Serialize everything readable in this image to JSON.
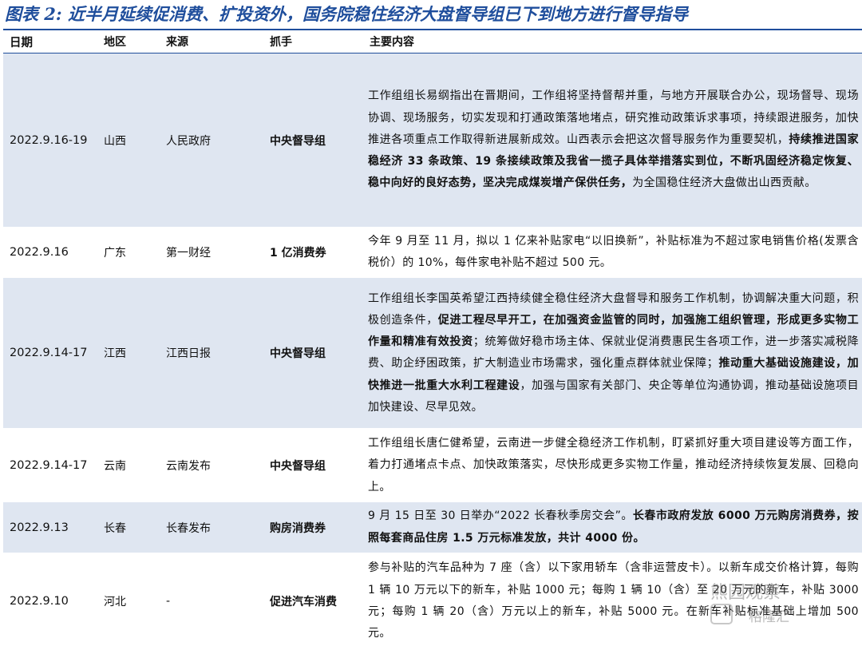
{
  "title": "图表 2: 近半月延续促消费、扩投资外，国务院稳住经济大盘督导组已下到地方进行督导指导",
  "table": {
    "headers": [
      "日期",
      "地区",
      "来源",
      "抓手",
      "主要内容"
    ],
    "rows": [
      {
        "date": "2022.9.16-19",
        "region": "山西",
        "source": "人民政府",
        "grip": "中央督导组",
        "content_plain_1": "工作组组长易纲指出在晋期间，工作组将坚持督帮并重，与地方开展联合办公，现场督导、现场协调、现场服务，切实发现和打通政策落地堵点，研究推动政策诉求事项，持续跟进服务，加快推进各项重点工作取得新进展新成效。山西表示会把这次督导服务作为重要契机，",
        "content_bold_1": "持续推进国家稳经济 33 条政策、19 条接续政策及我省一揽子具体举措落实到位，不断巩固经济稳定恢复、稳中向好的良好态势，坚决完成煤炭增产保供任务，",
        "content_plain_2": "为全国稳住经济大盘做出山西贡献。"
      },
      {
        "date": "2022.9.16",
        "region": "广东",
        "source": "第一财经",
        "grip": "1 亿消费券",
        "content_plain_1": "今年 9 月至 11 月，拟以 1 亿来补贴家电“以旧换新”，补贴标准为不超过家电销售价格(发票含税价）的 10%，每件家电补贴不超过 500 元。"
      },
      {
        "date": "2022.9.14-17",
        "region": "江西",
        "source": "江西日报",
        "grip": "中央督导组",
        "content_plain_1": "工作组组长李国英希望江西持续健全稳住经济大盘督导和服务工作机制，协调解决重大问题，积极创造条件，",
        "content_bold_1": "促进工程尽早开工，在加强资金监管的同时，加强施工组织管理，形成更多实物工作量和精准有效投资",
        "content_plain_2": "；统筹做好稳市场主体、保就业促消费惠民生各项工作，进一步落实减税降费、助企纾困政策，扩大制造业市场需求，强化重点群体就业保障；",
        "content_bold_2": "推动重大基础设施建设，加快推进一批重大水利工程建设",
        "content_plain_3": "，加强与国家有关部门、央企等单位沟通协调，推动基础设施项目加快建设、尽早见效。"
      },
      {
        "date": "2022.9.14-17",
        "region": "云南",
        "source": "云南发布",
        "grip": "中央督导组",
        "content_plain_1": "工作组组长唐仁健希望，云南进一步健全稳经济工作机制，盯紧抓好重大项目建设等方面工作，着力打通堵点卡点、加快政策落实，尽快形成更多实物工作量，推动经济持续恢复发展、回稳向上。"
      },
      {
        "date": "2022.9.13",
        "region": "长春",
        "source": "长春发布",
        "grip": "购房消费券",
        "content_plain_1": "9 月 15 日至 30 日举办“2022 长春秋季房交会”。",
        "content_bold_1": "长春市政府发放 6000 万元购房消费券，按照每套商品住房 1.5 万元标准发放，共计 4000 份。"
      },
      {
        "date": "2022.9.10",
        "region": "河北",
        "source": "-",
        "grip": "促进汽车消费",
        "content_plain_1": "参与补贴的汽车品种为 7 座（含）以下家用轿车（含非运营皮卡）。以新车成交价格计算，每购 1 辆 10 万元以下的新车，补贴 1000 元；每购 1 辆 10（含）至 20 万元的新车，补贴 3000 元；每购 1 辆 20（含）万元以上的新车，补贴 5000 元。在新车补贴标准基础上增加 500 元。"
      }
    ]
  },
  "watermark": {
    "line1": "熊园观察",
    "line2": "格隆汇"
  }
}
